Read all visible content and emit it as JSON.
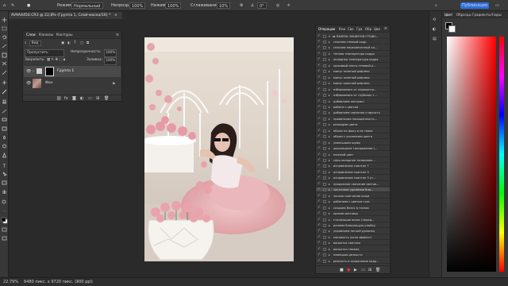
{
  "options_bar": {
    "mode_label": "Режим:",
    "mode_value": "Нормальный",
    "opacity_label": "Непрозр.:",
    "opacity_value": "100%",
    "flow_label": "Нажим:",
    "flow_value": "100%",
    "smooth_label": "Сглаживание:",
    "smooth_value": "10%",
    "angle_value": "0°",
    "publish_label": "Публикация"
  },
  "document_tab": {
    "title": "AV9A4450.CR3 @ 22,8% (Группа 1, Слой-маска/16) *"
  },
  "layers_panel": {
    "tabs": [
      "Слои",
      "Каналы",
      "Контуры"
    ],
    "filter_label": "Вид",
    "blend_mode": "Пропустить",
    "opacity_label": "Непрозрачность:",
    "opacity_value": "100%",
    "lock_label": "Закрепить:",
    "fill_label": "Заливка:",
    "fill_value": "100%",
    "layers": [
      {
        "name": "Группа 1"
      },
      {
        "name": "Фон"
      }
    ]
  },
  "actions_panel": {
    "tabs": [
      "Операции",
      "Кни",
      "Сво",
      "Гра",
      "Обр",
      "Цве"
    ],
    "set_name": "ПАНЕЛЬ ЭКШЕНОВ СТУДИ...",
    "items": [
      "спасаем темный кадр",
      "спасаем пересвеченный ка...",
      "теплая температура кадра",
      "холодная температура кадра",
      "красивый свето-теневой р...",
      "минус зеленый рефлекс",
      "минус зеленый рефлекс",
      "минус красный рефлекс",
      "избавляемся от переконтр...",
      "избавляемся от глубоких т...",
      "добавляем контраст",
      "работа с цветом",
      "добавляем свечения и яркость",
      "правильная насыщенность...",
      "разводим цвета",
      "объем по фону и на герое",
      "объем с усилением цвета",
      "уменьшаем шумы",
      "шоколадное тонирование (...",
      "нежный цвет",
      "серо-холодное тонирован...",
      "исправление скинтон 7",
      "исправление скинтон 3",
      "исправление скинтон 3 (п...",
      "продажное свечение светов...",
      "частичное удаление бли...",
      "только смягчение кожи",
      "работаем с цветом глаз",
      "создаем блеск в глазах",
      "красим ресницы",
      "стилизация волос (перед...",
      "делаем бликующую улыбку",
      "управляем легкой румянец",
      "матовость (окно эффект)",
      "виньетка светлая",
      "виньетка темная",
      "немецкая резкость",
      "резкость и сохранение кадр..."
    ],
    "selected_index": 25
  },
  "color_panel": {
    "tabs": [
      "Цвет",
      "Образцы",
      "Градиенты",
      "Узоры"
    ],
    "hue_color": "#ff0000"
  },
  "status_bar": {
    "zoom": "22,79%",
    "dimensions": "6480 пикс. x 9720 пикс. (300 ppi)"
  },
  "colors": {
    "accent": "#2d6fdf",
    "panel_bg": "#383838",
    "app_bg": "#2a2a2a"
  }
}
